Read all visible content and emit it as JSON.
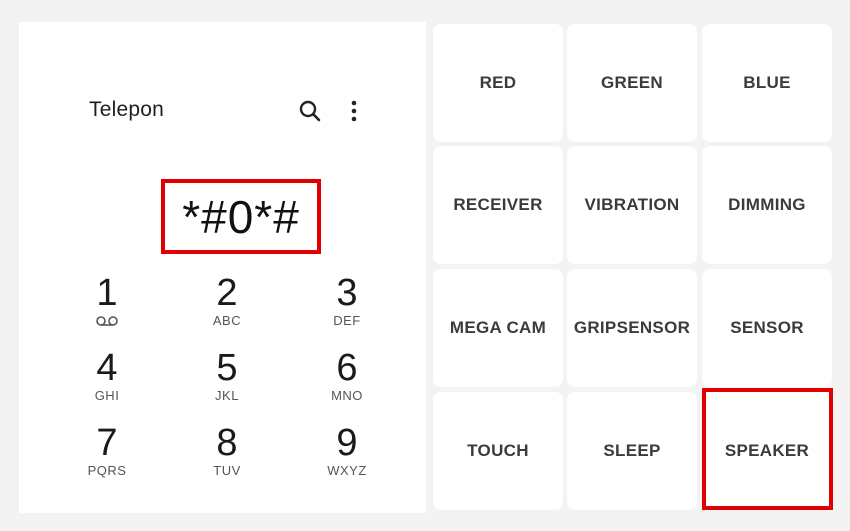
{
  "app": {
    "title": "Telepon"
  },
  "dialer": {
    "input_value": "*#0*#",
    "keys": [
      {
        "num": "1",
        "letters": "",
        "icon": "voicemail-icon"
      },
      {
        "num": "2",
        "letters": "ABC"
      },
      {
        "num": "3",
        "letters": "DEF"
      },
      {
        "num": "4",
        "letters": "GHI"
      },
      {
        "num": "5",
        "letters": "JKL"
      },
      {
        "num": "6",
        "letters": "MNO"
      },
      {
        "num": "7",
        "letters": "PQRS"
      },
      {
        "num": "8",
        "letters": "TUV"
      },
      {
        "num": "9",
        "letters": "WXYZ"
      }
    ]
  },
  "icons": {
    "search": "search-icon",
    "more": "more-vert-icon"
  },
  "tests": [
    {
      "label": "RED"
    },
    {
      "label": "GREEN"
    },
    {
      "label": "BLUE"
    },
    {
      "label": "RECEIVER"
    },
    {
      "label": "VIBRATION"
    },
    {
      "label": "DIMMING"
    },
    {
      "label": "MEGA CAM"
    },
    {
      "label": "GRIPSENSOR"
    },
    {
      "label": "SENSOR"
    },
    {
      "label": "TOUCH"
    },
    {
      "label": "SLEEP"
    },
    {
      "label": "SPEAKER"
    }
  ],
  "colors": {
    "highlight": "#e00000",
    "panel": "#ffffff",
    "background": "#f3f3f3"
  }
}
